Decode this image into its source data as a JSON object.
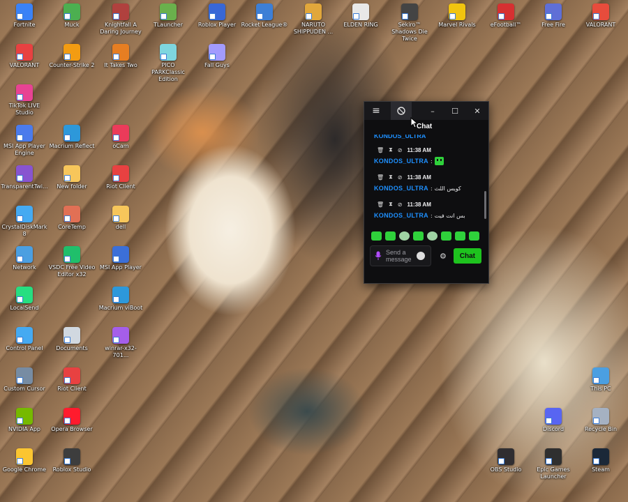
{
  "desktop": {
    "icons": [
      {
        "label": "Fortnite",
        "color": "#3a82f7"
      },
      {
        "label": "Muck",
        "color": "#4caf50"
      },
      {
        "label": "Knightfall A Daring Journey",
        "color": "#b0413e"
      },
      {
        "label": "TLauncher",
        "color": "#6ab04c"
      },
      {
        "label": "Roblox Player",
        "color": "#3867d6"
      },
      {
        "label": "Rocket League®",
        "color": "#3d7fd6"
      },
      {
        "label": "NARUTO SHIPPUDEN ...",
        "color": "#e1a73b"
      },
      {
        "label": "ELDEN RING",
        "color": "#e8e8e8"
      },
      {
        "label": "Sekiro™ Shadows Die Twice",
        "color": "#444444"
      },
      {
        "label": "Marvel Rivals",
        "color": "#f1c40f"
      },
      {
        "label": "eFootball™",
        "color": "#d63031"
      },
      {
        "label": "Free Fire",
        "color": "#5f6fd6"
      },
      {
        "label": "VALORANT",
        "color": "#e74c3c"
      },
      {
        "label": "VALORANT",
        "color": "#e84141"
      },
      {
        "label": "Counter-Strike 2",
        "color": "#f39c12"
      },
      {
        "label": "It Takes Two",
        "color": "#e67e22"
      },
      {
        "label": "PICO PARKClassic Edition",
        "color": "#7ed6df"
      },
      {
        "label": "Fall Guys",
        "color": "#a29bfe"
      },
      {
        "label": "TikTok LIVE Studio",
        "color": "#e84393"
      },
      {
        "label": "MSI App Player Engine",
        "color": "#4b7bec"
      },
      {
        "label": "Macrium Reflect",
        "color": "#2d98da"
      },
      {
        "label": "oCam",
        "color": "#eb3b5a"
      },
      {
        "label": "TransparentTwi...",
        "color": "#8854d0"
      },
      {
        "label": "New folder",
        "color": "#f7c65b"
      },
      {
        "label": "Riot Client",
        "color": "#e84141"
      },
      {
        "label": "CrystalDiskMark 8",
        "color": "#45aaf2"
      },
      {
        "label": "CoreTemp",
        "color": "#e17055"
      },
      {
        "label": "dell",
        "color": "#f7c65b"
      },
      {
        "label": "Network",
        "color": "#4b9fe1"
      },
      {
        "label": "VSDC Free Video Editor x32",
        "color": "#20bf6b"
      },
      {
        "label": "MSI App Player",
        "color": "#3b6fd8"
      },
      {
        "label": "LocalSend",
        "color": "#26de81"
      },
      {
        "label": "Macrium viBoot",
        "color": "#2d98da"
      },
      {
        "label": "Control Panel",
        "color": "#45aaf2"
      },
      {
        "label": "Documents",
        "color": "#d1d8e0"
      },
      {
        "label": "winrar-x32-701...",
        "color": "#a55eea"
      },
      {
        "label": "Custom Cursor",
        "color": "#778ca3"
      },
      {
        "label": "Riot Client",
        "color": "#e84141"
      },
      {
        "label": "This PC",
        "color": "#4b9fe1"
      },
      {
        "label": "NVIDIA App",
        "color": "#76b900"
      },
      {
        "label": "Opera Browser",
        "color": "#ff1b2d"
      },
      {
        "label": "Discord",
        "color": "#5865f2"
      },
      {
        "label": "Recycle Bin",
        "color": "#a5b1c2"
      },
      {
        "label": "Google Chrome",
        "color": "#fbc531"
      },
      {
        "label": "Roblox Studio",
        "color": "#3d3d3d"
      },
      {
        "label": "OBS Studio",
        "color": "#302e31"
      },
      {
        "label": "Epic Games Launcher",
        "color": "#2f2f2f"
      },
      {
        "label": "Steam",
        "color": "#1b2838"
      }
    ]
  },
  "chat_window": {
    "tooltip": "Chat",
    "menu_icon": "≡",
    "minimize": "–",
    "maximize": "☐",
    "close": "✕",
    "partial_top_user": "KONDOS_ULTRA",
    "messages": [
      {
        "time": "11:38 AM",
        "user": "KONDOS_ULTRA",
        "separator": ":",
        "text": "",
        "emote": true
      },
      {
        "time": "11:38 AM",
        "user": "KONDOS_ULTRA",
        "separator": ":",
        "text": "كويس اللث",
        "emote": false
      },
      {
        "time": "11:38 AM",
        "user": "KONDOS_ULTRA",
        "separator": ":",
        "text": "بس انت فيت",
        "emote": false
      }
    ],
    "input_placeholder": "Send a message",
    "chat_button": "Chat",
    "accent": "#1ec31e",
    "username_color": "#1e90ff"
  }
}
